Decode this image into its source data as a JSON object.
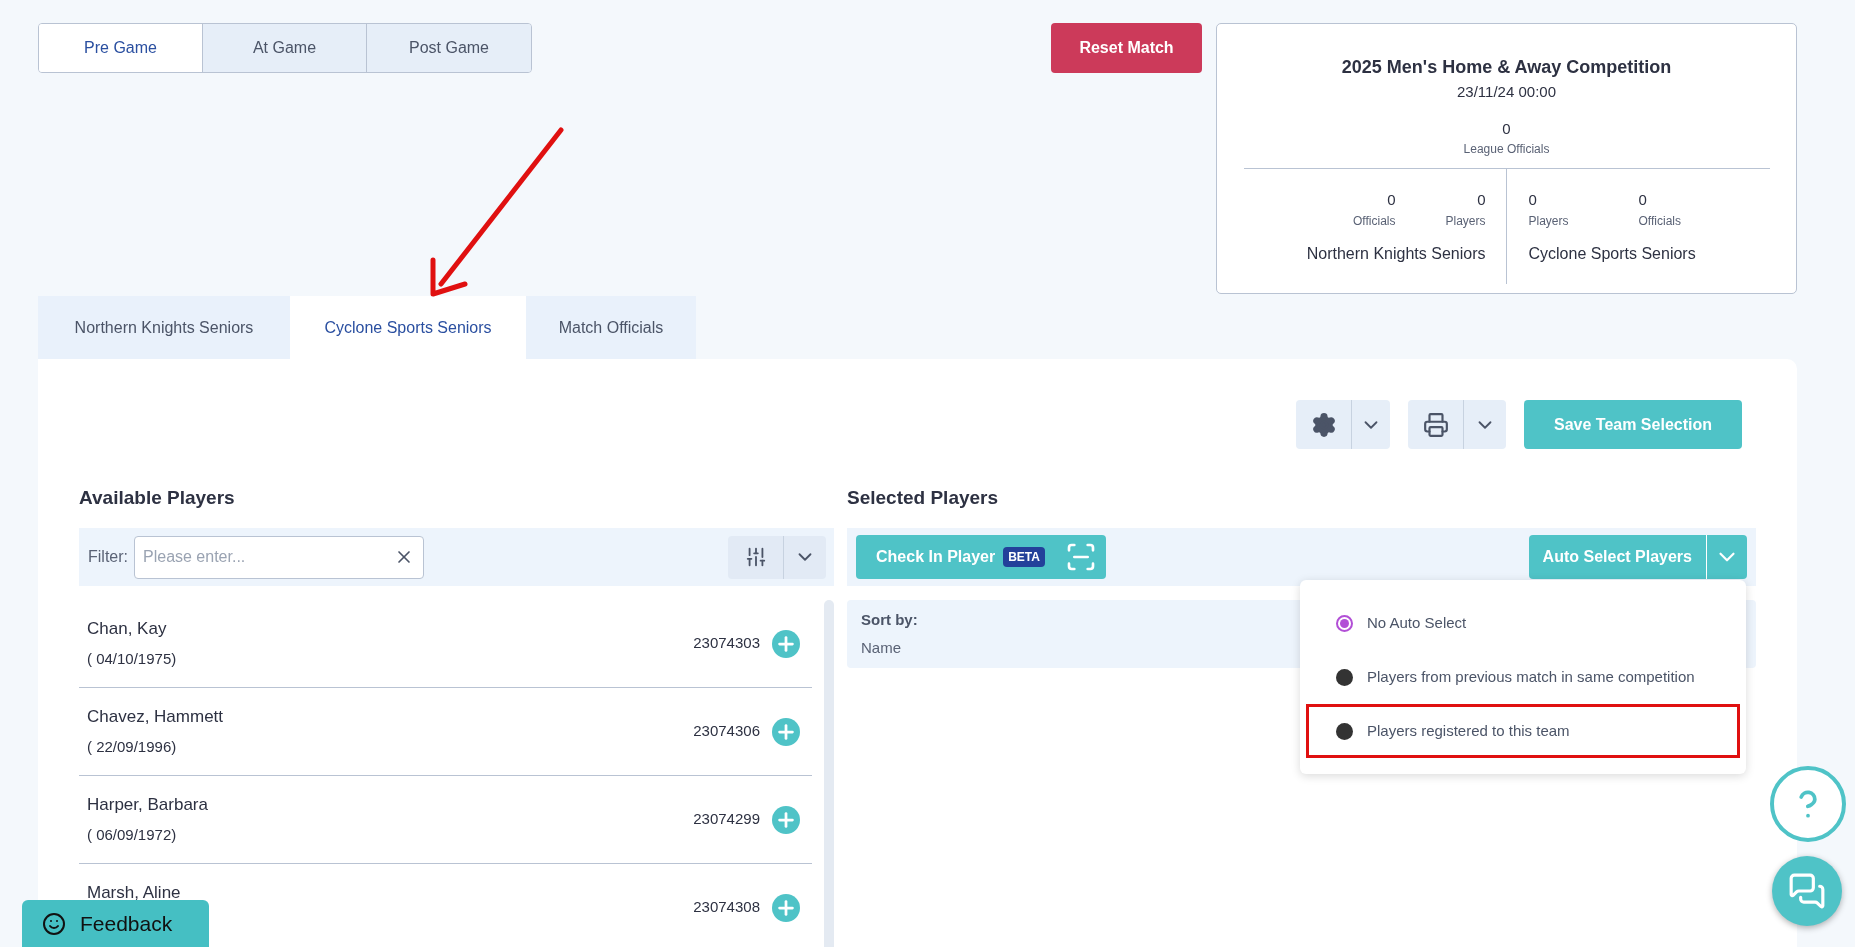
{
  "stage_tabs": [
    {
      "label": "Pre Game",
      "selected": true
    },
    {
      "label": "At Game",
      "selected": false
    },
    {
      "label": "Post Game",
      "selected": false
    }
  ],
  "reset_button": "Reset Match",
  "match_card": {
    "competition": "2025 Men's Home & Away Competition",
    "datetime": "23/11/24 00:00",
    "league_officials": {
      "value": "0",
      "label": "League Officials"
    },
    "home": {
      "team": "Northern Knights Seniors",
      "stats": [
        {
          "value": "0",
          "label": "Officials"
        },
        {
          "value": "0",
          "label": "Players"
        }
      ]
    },
    "away": {
      "team": "Cyclone Sports Seniors",
      "stats": [
        {
          "value": "0",
          "label": "Players"
        },
        {
          "value": "0",
          "label": "Officials"
        }
      ]
    }
  },
  "team_tabs": [
    {
      "label": "Northern Knights Seniors",
      "selected": false
    },
    {
      "label": "Cyclone Sports Seniors",
      "selected": true
    },
    {
      "label": "Match Officials",
      "selected": false
    }
  ],
  "save_button": "Save Team Selection",
  "available": {
    "title": "Available Players",
    "filter_label": "Filter:",
    "filter_placeholder": "Please enter...",
    "players": [
      {
        "name": "Chan, Kay",
        "dob": "( 04/10/1975)",
        "number": "23074303"
      },
      {
        "name": "Chavez, Hammett",
        "dob": "( 22/09/1996)",
        "number": "23074306"
      },
      {
        "name": "Harper, Barbara",
        "dob": "( 06/09/1972)",
        "number": "23074299"
      },
      {
        "name": "Marsh, Aline",
        "number": "23074308"
      }
    ]
  },
  "selected": {
    "title": "Selected Players",
    "check_in_button": "Check In Player",
    "check_in_badge": "BETA",
    "auto_select_button": "Auto Select Players",
    "sort_label": "Sort by:",
    "sort_value": "Name",
    "auto_select_menu": [
      {
        "label": "No Auto Select",
        "selected": true,
        "highlighted": false
      },
      {
        "label": "Players from previous match in same competition",
        "selected": false,
        "highlighted": false
      },
      {
        "label": "Players registered to this team",
        "selected": false,
        "highlighted": true
      }
    ]
  },
  "feedback_button": "Feedback"
}
